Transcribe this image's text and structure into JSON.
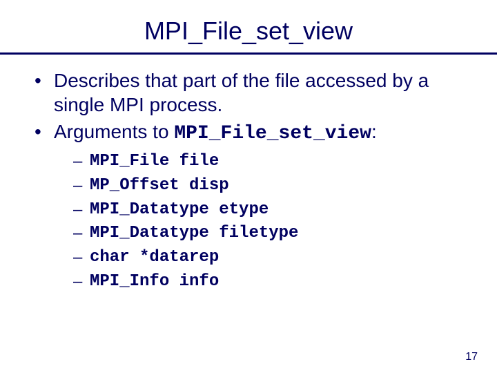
{
  "title": "MPI_File_set_view",
  "bullets": [
    {
      "text": "Describes that part of the file accessed by a single MPI process."
    },
    {
      "prefix": "Arguments to ",
      "code": "MPI_File_set_view",
      "suffix": ":"
    }
  ],
  "args": [
    "MPI_File file",
    "MP_Offset disp",
    "MPI_Datatype etype",
    "MPI_Datatype filetype",
    "char *datarep",
    "MPI_Info info"
  ],
  "page_number": "17"
}
